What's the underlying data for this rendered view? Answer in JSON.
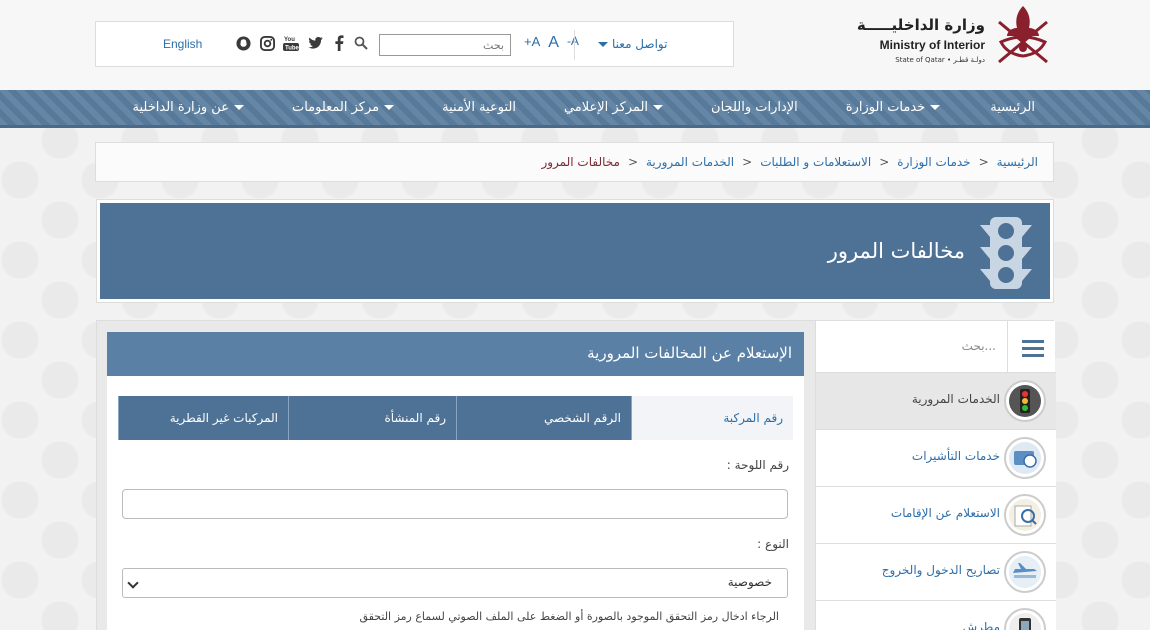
{
  "header": {
    "logo_ar": "وزارة الداخليـــــة",
    "logo_en": "Ministry of Interior",
    "logo_small": "State of Qatar • دولـة قطـر",
    "english_link": "English",
    "search_placeholder": "بحث",
    "font_decrease": "-A",
    "font_normal": "A",
    "font_increase": "+A",
    "contact_label": "تواصل معنا",
    "social_icons": [
      "snapchat-icon",
      "instagram-icon",
      "youtube-icon",
      "twitter-icon",
      "facebook-icon"
    ]
  },
  "nav": {
    "items": [
      {
        "label": "الرئيسية",
        "dropdown": false
      },
      {
        "label": "خدمات الوزارة",
        "dropdown": true
      },
      {
        "label": "الإدارات واللجان",
        "dropdown": false
      },
      {
        "label": "المركز الإعلامي",
        "dropdown": true
      },
      {
        "label": "التوعية الأمنية",
        "dropdown": false
      },
      {
        "label": "مركز المعلومات",
        "dropdown": true
      },
      {
        "label": "عن وزارة الداخلية",
        "dropdown": true
      }
    ]
  },
  "breadcrumb": {
    "items": [
      "الرئيسية",
      "خدمات الوزارة",
      "الاستعلامات و الطلبات",
      "الخدمات المرورية",
      "مخالفات المرور"
    ],
    "separator": ">"
  },
  "banner": {
    "title": "مخالفات المرور"
  },
  "panel": {
    "title": "الإستعلام عن المخالفات المرورية",
    "tabs": [
      "رقم المركبة",
      "الرقم الشخصي",
      "رقم المنشأة",
      "المركبات غير القطرية"
    ],
    "active_tab": 0,
    "plate_label": "رقم اللوحة :",
    "plate_value": "",
    "type_label": "النوع :",
    "type_value": "خصوصية",
    "captcha_note": "الرجاء ادخال رمز التحقق الموجود بالصورة أو الضغط على الملف الصوتي لسماع رمز التحقق"
  },
  "sidebar": {
    "search_placeholder": "بحث...",
    "items": [
      {
        "label": "الخدمات المرورية",
        "icon": "traffic-light-icon",
        "active": true
      },
      {
        "label": "خدمات التأشيرات",
        "icon": "visa-icon",
        "active": false
      },
      {
        "label": "الاستعلام عن الإقامات",
        "icon": "residency-icon",
        "active": false
      },
      {
        "label": "تصاريح الدخول والخروج",
        "icon": "airplane-icon",
        "active": false
      },
      {
        "label": "مطرش",
        "icon": "metrash-icon",
        "active": false
      }
    ]
  },
  "colors": {
    "nav_bg": "#5c7fa0",
    "banner_bg": "#4e7196",
    "link": "#2d6ea8",
    "maroon": "#8a1f2d"
  }
}
